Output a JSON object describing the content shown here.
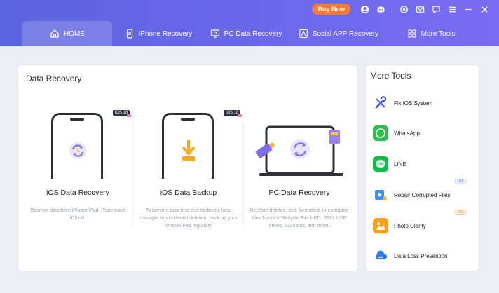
{
  "topbar": {
    "buy_now": "Buy Now",
    "icons": [
      "avatar-icon",
      "discord-icon",
      "settings-icon",
      "mail-icon",
      "feedback-icon",
      "menu-icon",
      "minimize-icon",
      "close-icon"
    ]
  },
  "tabs": [
    {
      "label": "HOME",
      "icon": "home-icon",
      "active": true
    },
    {
      "label": "iPhone Recovery",
      "icon": "iphone-icon"
    },
    {
      "label": "PC Data Recovery",
      "icon": "pc-icon"
    },
    {
      "label": "Social APP Recovery",
      "icon": "social-app-icon"
    },
    {
      "label": "More Tools",
      "icon": "grid-icon"
    }
  ],
  "data_recovery": {
    "title": "Data Recovery",
    "cards": [
      {
        "title": "iOS Data Recovery",
        "badge": "iOS 18",
        "desc": "Recover data from iPhone/iPad, iTunes and iCloud."
      },
      {
        "title": "iOS Data Backup",
        "badge": "iOS 18",
        "desc": "To prevent data loss due to device loss, damage, or accidental deletion, back up your iPhone/iPad regularly."
      },
      {
        "title": "PC Data Recovery",
        "desc": "Recover deleted, lost, formatted, or corrupted files from the Recycle Bin, HDD, SSD, USB drives, SD cards, and more."
      }
    ]
  },
  "more_tools": {
    "title": "More Tools",
    "items": [
      {
        "label": "Fix iOS System",
        "icon": "wrench-icon"
      },
      {
        "label": "WhatsApp",
        "icon": "whatsapp-icon"
      },
      {
        "label": "LINE",
        "icon": "line-icon"
      },
      {
        "label": "Repair Corrupted Files",
        "icon": "repair-files-icon",
        "tag": "AI"
      },
      {
        "label": "Photo Clarity",
        "icon": "photo-clarity-icon",
        "tag": "AI"
      },
      {
        "label": "Data Loss Prevention",
        "icon": "cloud-icon"
      }
    ]
  },
  "colors": {
    "header_start": "#5a64dd",
    "header_end": "#7a6cf3",
    "buy_now": "#ff7a2e",
    "accent": "#7b74f0"
  }
}
